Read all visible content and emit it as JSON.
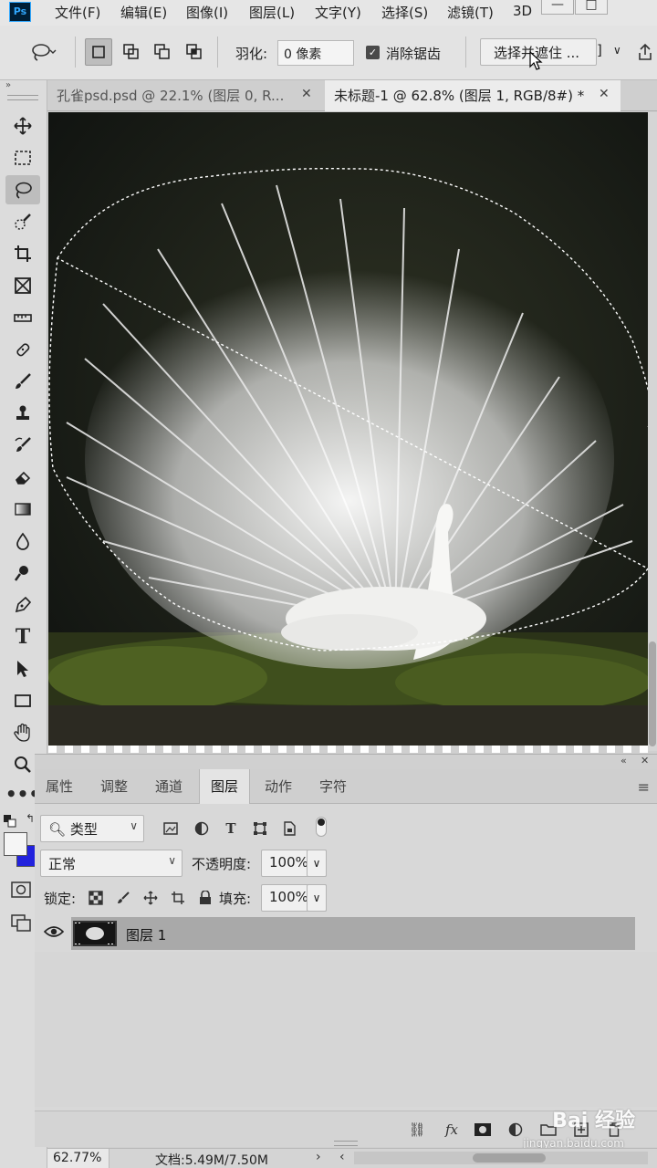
{
  "menubar": {
    "logo": "Ps",
    "items": [
      "文件(F)",
      "编辑(E)",
      "图像(I)",
      "图层(L)",
      "文字(Y)",
      "选择(S)",
      "滤镜(T)",
      "3D"
    ]
  },
  "options_bar": {
    "feather_label": "羽化:",
    "feather_value": "0 像素",
    "antialias_label": "消除锯齿",
    "antialias_checked": true,
    "select_mask_button": "选择并遮住 ..."
  },
  "tabs": [
    {
      "label": "孔雀psd.psd @ 22.1% (图层 0, R...",
      "active": false
    },
    {
      "label": "未标题-1 @ 62.8% (图层 1, RGB/8#) *",
      "active": true
    }
  ],
  "tools": [
    "move-icon",
    "marquee-icon",
    "lasso-icon",
    "quick-select-icon",
    "crop-icon",
    "frame-icon",
    "ruler-icon",
    "healing-icon",
    "brush-icon",
    "stamp-icon",
    "history-brush-icon",
    "eraser-icon",
    "gradient-icon",
    "blur-icon",
    "dodge-icon",
    "pen-icon",
    "type-icon",
    "path-select-icon",
    "rectangle-icon",
    "hand-icon",
    "zoom-icon",
    "more-icon"
  ],
  "active_tool": "lasso-icon",
  "colors": {
    "foreground": "#f5f5f5",
    "background": "#2222dd"
  },
  "panel": {
    "tabs": [
      "属性",
      "调整",
      "通道",
      "图层",
      "动作",
      "字符"
    ],
    "active_tab": "图层",
    "filter_kind": "类型",
    "blend_mode": "正常",
    "opacity_label": "不透明度:",
    "opacity_value": "100%",
    "lock_label": "锁定:",
    "fill_label": "填充:",
    "fill_value": "100%",
    "layers": [
      {
        "name": "图层 1",
        "visible": true,
        "selected": true
      }
    ]
  },
  "status": {
    "zoom": "62.77%",
    "doc_info": "文档:5.49M/7.50M"
  },
  "watermark": {
    "logo": "Bai 经验",
    "url": "jingyan.baidu.com"
  }
}
